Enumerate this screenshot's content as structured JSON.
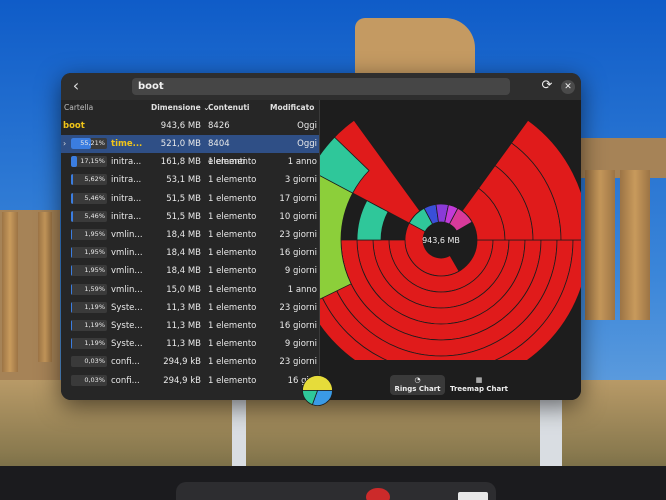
{
  "header": {
    "path": "boot"
  },
  "columns": {
    "folder": "Cartella",
    "size": "Dimensione",
    "contents": "Contenuti",
    "modified": "Modificato"
  },
  "root": {
    "name": "boot",
    "size": "943,6 MB",
    "contents": "8426 elementi",
    "modified": "Oggi"
  },
  "rows": [
    {
      "pct": 55.21,
      "pct_label": "55,21%",
      "name": "time...",
      "size": "521,0 MB",
      "contents": "8404 elementi",
      "modified": "Oggi",
      "selected": true,
      "expandable": true
    },
    {
      "pct": 17.15,
      "pct_label": "17,15%",
      "name": "initra...",
      "size": "161,8 MB",
      "contents": "1 elemento",
      "modified": "1 anno"
    },
    {
      "pct": 5.62,
      "pct_label": "5,62%",
      "name": "initra...",
      "size": "53,1 MB",
      "contents": "1 elemento",
      "modified": "3 giorni"
    },
    {
      "pct": 5.46,
      "pct_label": "5,46%",
      "name": "initra...",
      "size": "51,5 MB",
      "contents": "1 elemento",
      "modified": "17 giorni"
    },
    {
      "pct": 5.46,
      "pct_label": "5,46%",
      "name": "initra...",
      "size": "51,5 MB",
      "contents": "1 elemento",
      "modified": "10 giorni"
    },
    {
      "pct": 1.95,
      "pct_label": "1,95%",
      "name": "vmlin...",
      "size": "18,4 MB",
      "contents": "1 elemento",
      "modified": "23 giorni"
    },
    {
      "pct": 1.95,
      "pct_label": "1,95%",
      "name": "vmlin...",
      "size": "18,4 MB",
      "contents": "1 elemento",
      "modified": "16 giorni"
    },
    {
      "pct": 1.95,
      "pct_label": "1,95%",
      "name": "vmlin...",
      "size": "18,4 MB",
      "contents": "1 elemento",
      "modified": "9 giorni"
    },
    {
      "pct": 1.59,
      "pct_label": "1,59%",
      "name": "vmlin...",
      "size": "15,0 MB",
      "contents": "1 elemento",
      "modified": "1 anno"
    },
    {
      "pct": 1.19,
      "pct_label": "1,19%",
      "name": "Syste...",
      "size": "11,3 MB",
      "contents": "1 elemento",
      "modified": "23 giorni"
    },
    {
      "pct": 1.19,
      "pct_label": "1,19%",
      "name": "Syste...",
      "size": "11,3 MB",
      "contents": "1 elemento",
      "modified": "16 giorni"
    },
    {
      "pct": 1.19,
      "pct_label": "1,19%",
      "name": "Syste...",
      "size": "11,3 MB",
      "contents": "1 elemento",
      "modified": "9 giorni"
    },
    {
      "pct": 0.03,
      "pct_label": "0,03%",
      "name": "confi...",
      "size": "294,9 kB",
      "contents": "1 elemento",
      "modified": "23 giorni"
    },
    {
      "pct": 0.03,
      "pct_label": "0,03%",
      "name": "confi...",
      "size": "294,9 kB",
      "contents": "1 elemento",
      "modified": "16 gi..."
    }
  ],
  "chart": {
    "center_label": "943,6 MB"
  },
  "tabs": {
    "rings": "Rings Chart",
    "treemap": "Treemap Chart"
  },
  "colors": {
    "accent": "#3b7de0",
    "ring_red": "#e01b1b",
    "ring_green": "#8ccf3a",
    "ring_teal": "#2fc79a"
  }
}
